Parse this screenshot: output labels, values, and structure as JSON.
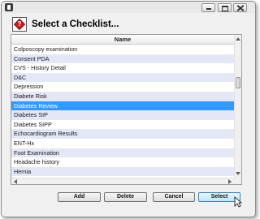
{
  "window": {
    "title_icon": "app-icon",
    "controls": [
      "minimize-icon",
      "maximize-icon",
      "close-icon"
    ]
  },
  "dialog": {
    "title": "Select a Checklist...",
    "icon": "checklist-diamond-icon",
    "icon_mark": "?",
    "icon_color": "#d21f1f"
  },
  "list": {
    "column_header": "Name",
    "items": [
      "Colposcopy examination",
      "Consent PDA",
      "CVS - History Detail",
      "D&C",
      "Depression",
      "Diabete Risk",
      "Diabetes Review",
      "Diabetes SIP",
      "Diabetes SIPP",
      "Echocardiogram Results",
      "ENT-Hx",
      "Foot Examination",
      "Headache history",
      "Hernia"
    ],
    "selected_index": 6,
    "selected_color": "#3399ff",
    "alt_row_color": "#e3e7f6"
  },
  "buttons": {
    "add": "Add",
    "delete": "Delete",
    "cancel": "Cancel",
    "select": "Select"
  }
}
